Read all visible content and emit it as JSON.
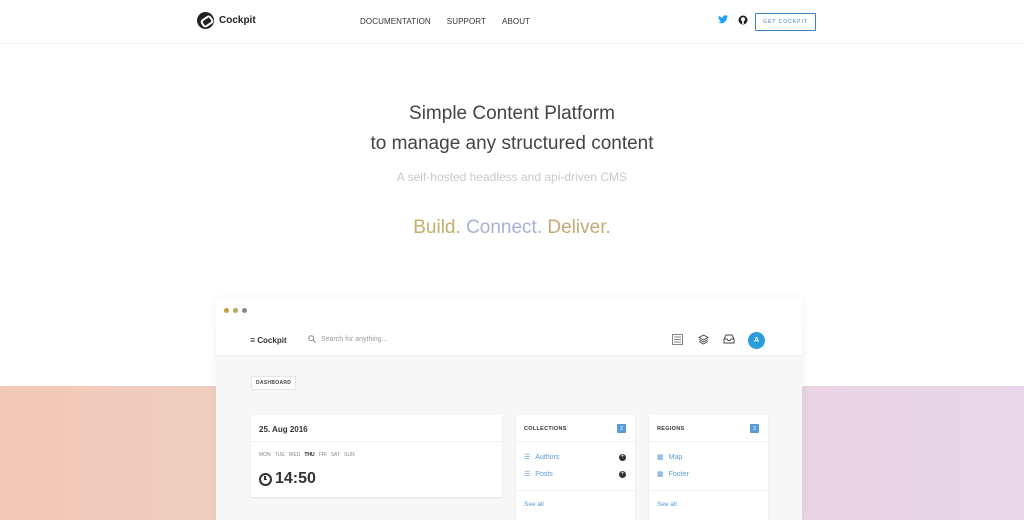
{
  "nav": {
    "logo_text": "Cockpit",
    "links": [
      "DOCUMENTATION",
      "SUPPORT",
      "ABOUT"
    ],
    "icons": [
      "twitter-icon",
      "github-icon"
    ],
    "cta_label": "GET COCKPIT"
  },
  "hero": {
    "title_line1": "Simple Content Platform",
    "title_line2": "to manage any structured content",
    "subtitle": "A self-hosted headless and api-driven CMS",
    "tagline": [
      "Build.",
      "Connect.",
      "Deliver."
    ]
  },
  "colors": {
    "accent": "#3b82c4",
    "tag_build": "#c4b06a",
    "tag_connect": "#a6b1d4",
    "tag_deliver": "#c4aa74",
    "band_left": "#f2c7b5",
    "band_right": "#e7d5e9",
    "avatar": "#2b9cde",
    "window_dots": [
      "#c4a03a",
      "#b8a96a",
      "#8a8a8a"
    ]
  },
  "app": {
    "brand": "Cockpit",
    "search_placeholder": "Search for anything...",
    "toolbar_icons": [
      "dashboard-icon",
      "layers-icon",
      "inbox-icon"
    ],
    "avatar_letter": "A",
    "breadcrumb": "DASHBOARD",
    "date_card": {
      "date": "25. Aug 2016",
      "weekdays": [
        "MON",
        "TUE",
        "WED",
        "THU",
        "FRI",
        "SAT",
        "SUN"
      ],
      "active_day": "THU",
      "time": "14:50"
    },
    "collections": {
      "title": "COLLECTIONS",
      "count": "2",
      "items": [
        "Authors",
        "Posts"
      ],
      "see_all": "See all"
    },
    "regions": {
      "title": "REGIONS",
      "count": "2",
      "items": [
        "Map",
        "Footer"
      ],
      "see_all": "See all"
    }
  }
}
